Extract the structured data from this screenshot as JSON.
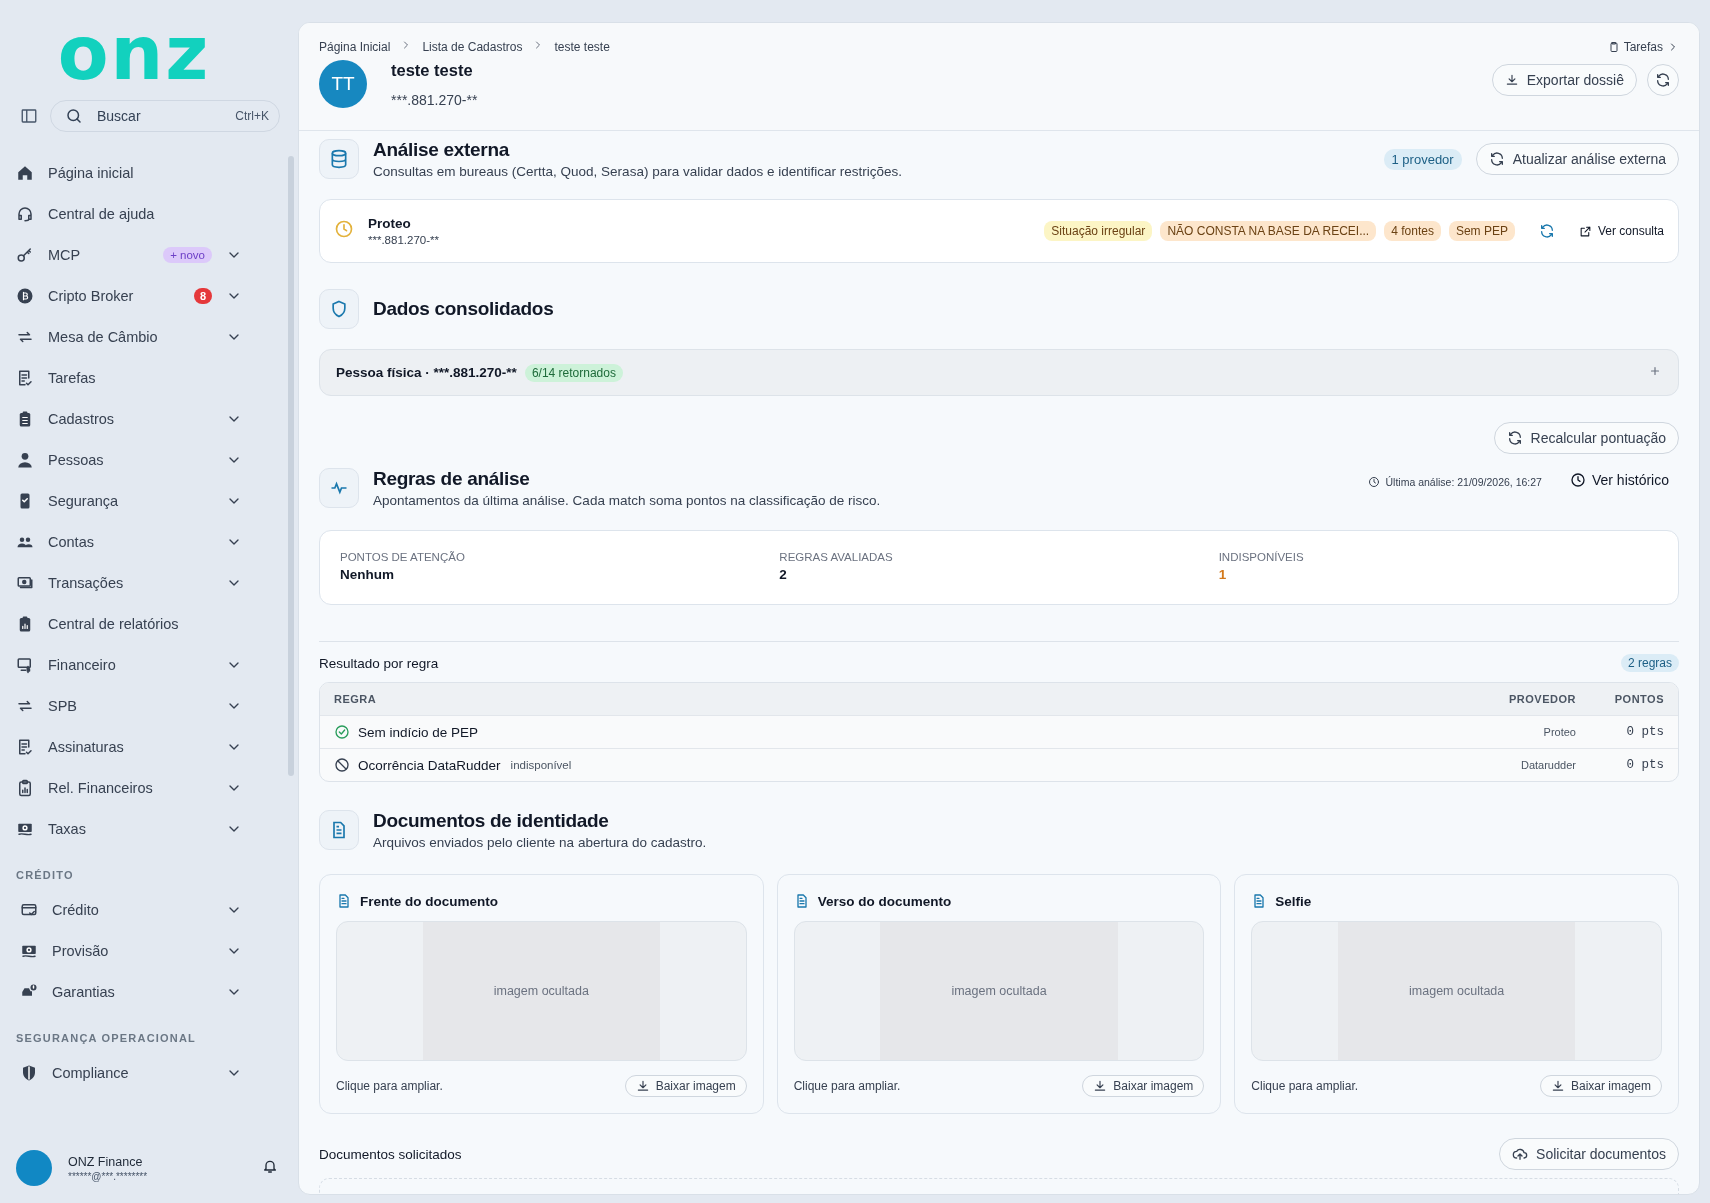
{
  "sidebar": {
    "logo": "onz",
    "search": {
      "placeholder": "Buscar",
      "shortcut": "Ctrl+K"
    },
    "items": [
      {
        "label": "Página inicial",
        "expandable": false
      },
      {
        "label": "Central de ajuda",
        "expandable": false
      },
      {
        "label": "MCP",
        "expandable": true,
        "badge": {
          "text": "+ novo",
          "kind": "new"
        }
      },
      {
        "label": "Cripto Broker",
        "expandable": true,
        "badge": {
          "text": "8",
          "kind": "count"
        }
      },
      {
        "label": "Mesa de Câmbio",
        "expandable": true
      },
      {
        "label": "Tarefas",
        "expandable": false
      },
      {
        "label": "Cadastros",
        "expandable": true
      },
      {
        "label": "Pessoas",
        "expandable": true
      },
      {
        "label": "Segurança",
        "expandable": true
      },
      {
        "label": "Contas",
        "expandable": true
      },
      {
        "label": "Transações",
        "expandable": true
      },
      {
        "label": "Central de relatórios",
        "expandable": false
      },
      {
        "label": "Financeiro",
        "expandable": true
      },
      {
        "label": "SPB",
        "expandable": true
      },
      {
        "label": "Assinaturas",
        "expandable": true
      },
      {
        "label": "Rel. Financeiros",
        "expandable": true
      },
      {
        "label": "Taxas",
        "expandable": true
      }
    ],
    "sections": [
      {
        "heading": "CRÉDITO",
        "items": [
          {
            "label": "Crédito",
            "expandable": true
          },
          {
            "label": "Provisão",
            "expandable": true
          },
          {
            "label": "Garantias",
            "expandable": true
          }
        ]
      },
      {
        "heading": "SEGURANÇA OPERACIONAL",
        "items": [
          {
            "label": "Compliance",
            "expandable": true
          }
        ]
      }
    ],
    "user": {
      "name": "ONZ Finance",
      "email": "******@***.********"
    }
  },
  "breadcrumb": [
    "Página Inicial",
    "Lista de Cadastros",
    "teste teste"
  ],
  "tasks_link": "Tarefas",
  "profile": {
    "initials": "TT",
    "name": "teste teste",
    "document": "***.881.270-**"
  },
  "header_buttons": {
    "export": "Exportar dossiê"
  },
  "external_analysis": {
    "title": "Análise externa",
    "subtitle": "Consultas em bureaus (Certta, Quod, Serasa) para validar dados e identificar restrições.",
    "provider_count": "1 provedor",
    "update_button": "Atualizar análise externa",
    "providers": [
      {
        "name": "Proteo",
        "document": "***.881.270-**",
        "tags": [
          {
            "text": "Situação irregular",
            "color": "#fcf5c5"
          },
          {
            "text": "NÃO CONSTA NA BASE DA RECEI...",
            "color": "#fde6cc"
          },
          {
            "text": "4 fontes",
            "color": "#fde6cc"
          },
          {
            "text": "Sem PEP",
            "color": "#fde6cc"
          }
        ],
        "link": "Ver consulta"
      }
    ]
  },
  "consolidated": {
    "title": "Dados consolidados",
    "row": {
      "label": "Pessoa física · ***.881.270-**",
      "badge": "6/14 retornados",
      "expanded": false
    }
  },
  "rules": {
    "recalc_button": "Recalcular pontuação",
    "title": "Regras de análise",
    "subtitle": "Apontamentos da última análise. Cada match soma pontos na classificação de risco.",
    "last_analysis": "Última análise: 21/09/2026, 16:27",
    "history_button": "Ver histórico",
    "stats": [
      {
        "label": "PONTOS DE ATENÇÃO",
        "value": "Nenhum",
        "color": "#111827"
      },
      {
        "label": "REGRAS AVALIADAS",
        "value": "2",
        "color": "#111827"
      },
      {
        "label": "INDISPONÍVEIS",
        "value": "1",
        "color": "#d3791b"
      }
    ],
    "results_title": "Resultado por regra",
    "results_count": "2 regras",
    "table": {
      "columns": [
        "REGRA",
        "PROVEDOR",
        "PONTOS"
      ],
      "rows": [
        {
          "rule": "Sem indício de PEP",
          "kind": "ok",
          "provider": "Proteo",
          "points": "0 pts"
        },
        {
          "rule": "Ocorrência DataRudder",
          "kind": "unavailable",
          "note": "indisponível",
          "provider": "Datarudder",
          "points": "0 pts"
        }
      ]
    }
  },
  "documents": {
    "title": "Documentos de identidade",
    "subtitle": "Arquivos enviados pelo cliente na abertura do cadastro.",
    "cards": [
      {
        "title": "Frente do documento",
        "placeholder": "imagem ocultada",
        "hint": "Clique para ampliar.",
        "button": "Baixar imagem"
      },
      {
        "title": "Verso do documento",
        "placeholder": "imagem ocultada",
        "hint": "Clique para ampliar.",
        "button": "Baixar imagem"
      },
      {
        "title": "Selfie",
        "placeholder": "imagem ocultada",
        "hint": "Clique para ampliar.",
        "button": "Baixar imagem"
      }
    ],
    "requested_title": "Documentos solicitados",
    "request_button": "Solicitar documentos"
  }
}
